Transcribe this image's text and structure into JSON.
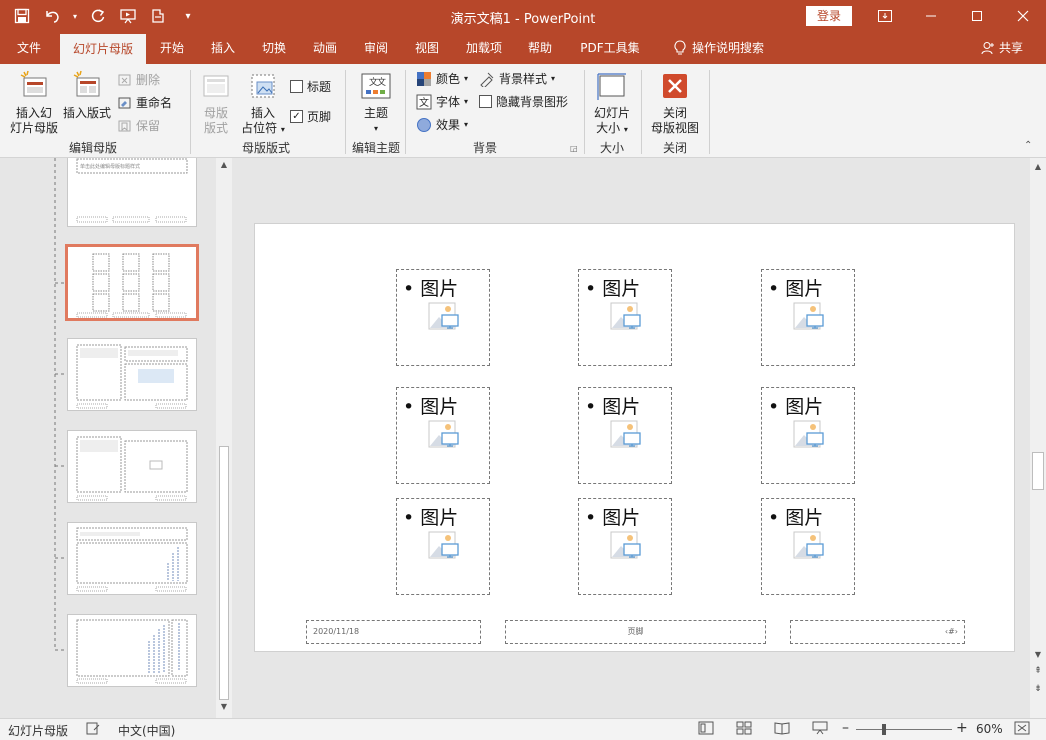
{
  "titlebar": {
    "title": "演示文稿1  -  PowerPoint",
    "login": "登录",
    "colors": {
      "brand": "#b7472a"
    }
  },
  "tabs": [
    {
      "label": "文件"
    },
    {
      "label": "幻灯片母版",
      "active": true
    },
    {
      "label": "开始"
    },
    {
      "label": "插入"
    },
    {
      "label": "切换"
    },
    {
      "label": "动画"
    },
    {
      "label": "审阅"
    },
    {
      "label": "视图"
    },
    {
      "label": "加载项"
    },
    {
      "label": "帮助"
    },
    {
      "label": "PDF工具集"
    }
  ],
  "tellme": "操作说明搜索",
  "share": "共享",
  "ribbon": {
    "edit_master": {
      "group": "编辑母版",
      "insert_master_1": "插入幻",
      "insert_master_2": "灯片母版",
      "insert_layout": "插入版式",
      "delete": "删除",
      "rename": "重命名",
      "preserve": "保留"
    },
    "master_layout": {
      "group": "母版版式",
      "master_layout_1": "母版",
      "master_layout_2": "版式",
      "insert_ph_1": "插入",
      "insert_ph_2": "占位符",
      "title_cb": "标题",
      "footer_cb": "页脚"
    },
    "edit_theme": {
      "group": "编辑主题",
      "theme": "主题"
    },
    "background": {
      "group": "背景",
      "colors": "颜色",
      "fonts": "字体",
      "effects": "效果",
      "bg_styles": "背景样式",
      "hide_bg": "隐藏背景图形"
    },
    "size": {
      "group": "大小",
      "slide_size_1": "幻灯片",
      "slide_size_2": "大小"
    },
    "close": {
      "group": "关闭",
      "close_1": "关闭",
      "close_2": "母版视图"
    }
  },
  "thumb_text": {
    "title_style": "单击此处编辑母版标题样式"
  },
  "slide": {
    "placeholder_label": "图片",
    "footer_date": "2020/11/18",
    "footer_text": "页脚",
    "footer_num": "‹#›"
  },
  "status": {
    "view": "幻灯片母版",
    "lang": "中文(中国)",
    "zoom": "60%"
  }
}
